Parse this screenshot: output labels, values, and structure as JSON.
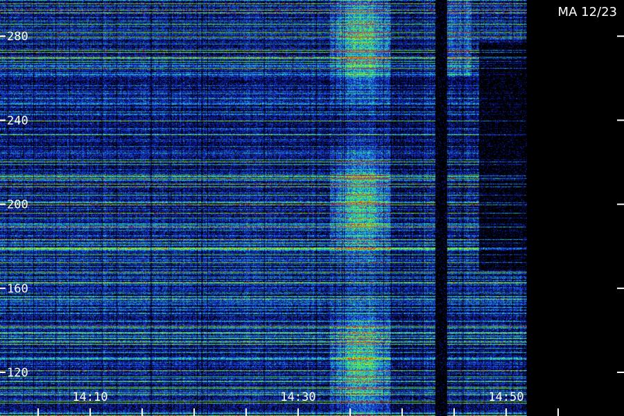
{
  "station_label": "MA 12/23",
  "chart_data": {
    "type": "heatmap",
    "title": "MA 12/23",
    "xlabel": "",
    "ylabel": "",
    "x_ticks": [
      "14:10",
      "14:30",
      "14:50"
    ],
    "x_range": [
      "14:05",
      "14:55"
    ],
    "y_ticks": [
      120,
      160,
      200,
      240,
      280
    ],
    "y_range": [
      110,
      295
    ],
    "colormap": [
      "#000000",
      "#0a1a9c",
      "#1e4bd8",
      "#1fb5c9",
      "#3fe07a",
      "#a6f014",
      "#e23a1c"
    ],
    "features": {
      "burst_start": "14:33",
      "burst_peak": "14:36",
      "data_gap": "14:45"
    },
    "grid": false
  }
}
